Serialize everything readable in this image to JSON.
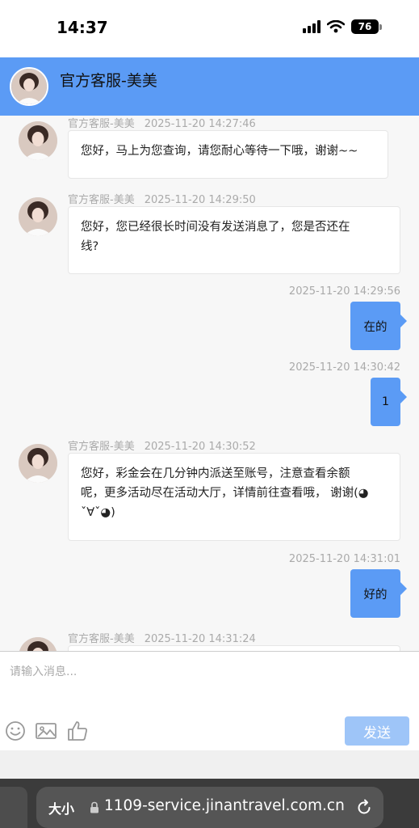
{
  "status_bar": {
    "time": "14:37",
    "battery": "76"
  },
  "header": {
    "title": "官方客服-美美"
  },
  "messages": [
    {
      "sender": "官方客服-美美",
      "time": "2025-11-20 14:27:46",
      "text": "您好，马上为您查询，请您耐心等待一下哦，谢谢~~"
    },
    {
      "sender": "官方客服-美美",
      "time": "2025-11-20 14:29:50",
      "line1": "您好，您已经很长时间没有发送消息了，您是否还在",
      "line2": "线?"
    },
    {
      "time": "2025-11-20 14:29:56",
      "text": "在的"
    },
    {
      "time": "2025-11-20 14:30:42",
      "text": "1"
    },
    {
      "sender": "官方客服-美美",
      "time": "2025-11-20 14:30:52",
      "line1": "您好，彩金会在几分钟内派送至账号，注意查看余额",
      "line2": "呢，更多活动尽在活动大厅，详情前往查看哦， 谢谢(◕",
      "line3": "ˇ∀ˇ◕)"
    },
    {
      "time": "2025-11-20 14:31:01",
      "text": "好的"
    },
    {
      "sender": "官方客服-美美",
      "time": "2025-11-20 14:31:24"
    }
  ],
  "composer": {
    "placeholder": "请输入消息...",
    "send_label": "发送"
  },
  "browser": {
    "text_size_label": "大小",
    "url": "1109-service.jinantravel.com.cn"
  },
  "colors": {
    "brand": "#5b9bf5",
    "send_disabled": "#9ec5f8"
  }
}
